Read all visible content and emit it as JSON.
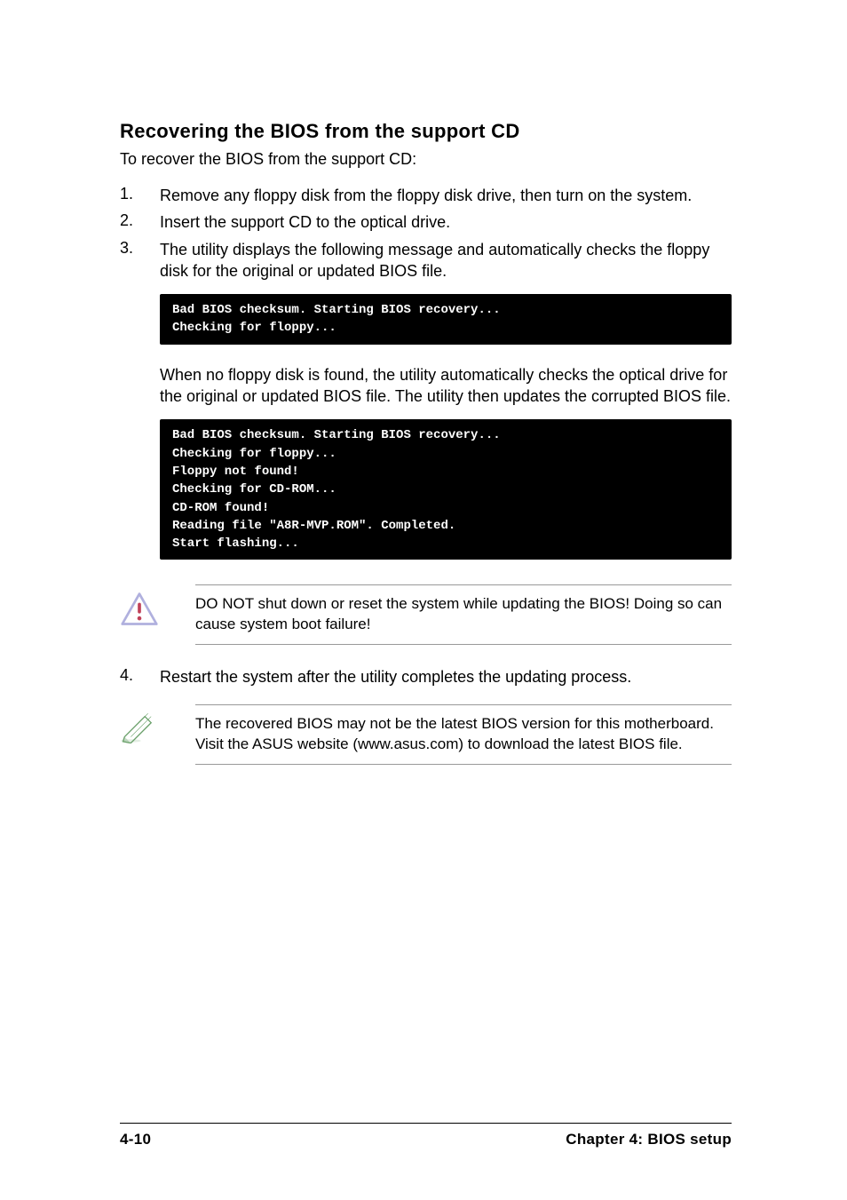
{
  "heading": "Recovering the BIOS from the support CD",
  "intro": "To recover the BIOS from the support CD:",
  "steps": {
    "s1": {
      "num": "1.",
      "text": "Remove any floppy disk from the floppy disk drive, then turn on the system."
    },
    "s2": {
      "num": "2.",
      "text": "Insert the support CD to the optical drive."
    },
    "s3": {
      "num": "3.",
      "text": "The utility displays the following message and automatically checks the floppy disk for the original or updated BIOS file."
    },
    "s4": {
      "num": "4.",
      "text": "Restart the system after the utility completes the updating process."
    }
  },
  "terminal1": "Bad BIOS checksum. Starting BIOS recovery...\nChecking for floppy...",
  "para_after_term1": "When no floppy disk is found, the utility automatically checks the optical drive for the original or updated BIOS file. The utility then updates the corrupted BIOS file.",
  "terminal2": "Bad BIOS checksum. Starting BIOS recovery...\nChecking for floppy...\nFloppy not found!\nChecking for CD-ROM...\nCD-ROM found!\nReading file \"A8R-MVP.ROM\". Completed.\nStart flashing...",
  "warning_text": "DO NOT shut down or reset the system while updating the BIOS! Doing so can cause system boot failure!",
  "note_text": "The recovered BIOS may not be the latest BIOS version for this motherboard. Visit the ASUS website (www.asus.com) to download the latest BIOS file.",
  "footer": {
    "left": "4-10",
    "right": "Chapter 4: BIOS setup"
  }
}
